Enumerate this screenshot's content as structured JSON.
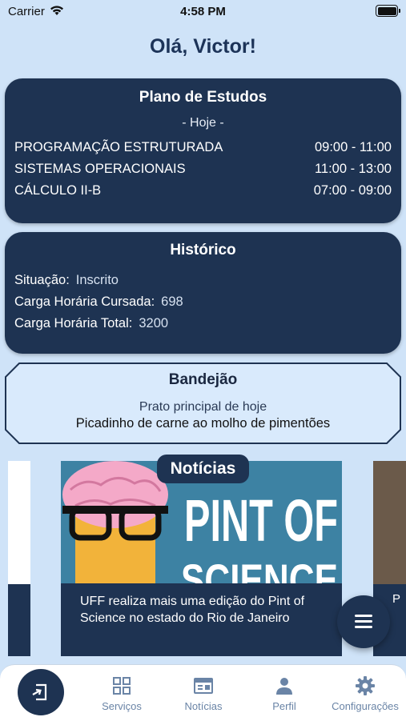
{
  "status_bar": {
    "carrier": "Carrier",
    "time": "4:58 PM"
  },
  "greeting": "Olá, Victor!",
  "study_plan": {
    "title": "Plano de Estudos",
    "day_label": "- Hoje -",
    "classes": [
      {
        "name": "PROGRAMAÇÃO ESTRUTURADA",
        "time": "09:00 - 11:00"
      },
      {
        "name": "SISTEMAS OPERACIONAIS",
        "time": "11:00 - 13:00"
      },
      {
        "name": "CÁLCULO II-B",
        "time": "07:00 - 09:00"
      }
    ]
  },
  "history": {
    "title": "Histórico",
    "rows": [
      {
        "label": "Situação:",
        "value": "Inscrito"
      },
      {
        "label": "Carga Horária Cursada:",
        "value": "698"
      },
      {
        "label": "Carga Horária Total:",
        "value": "3200"
      }
    ]
  },
  "bandejao": {
    "title": "Bandejão",
    "subtitle": "Prato principal de hoje",
    "dish": "Picadinho de carne ao molho de pimentões"
  },
  "news": {
    "tag": "Notícias",
    "image_text": "PINT OF",
    "image_text_2": "SCIENCE",
    "caption": "UFF realiza mais uma edição do Pint of Science no estado do Rio de Janeiro",
    "next_peek": "P"
  },
  "tab_bar": {
    "items": [
      {
        "label": "Serviços",
        "icon": "grid-icon"
      },
      {
        "label": "Notícias",
        "icon": "newspaper-icon"
      },
      {
        "label": "Perfil",
        "icon": "person-icon"
      },
      {
        "label": "Configurações",
        "icon": "gear-icon"
      }
    ],
    "home_icon": "enter-icon"
  },
  "colors": {
    "background": "#cfe3f8",
    "card": "#1e3352",
    "tab_label": "#6a84a6"
  }
}
